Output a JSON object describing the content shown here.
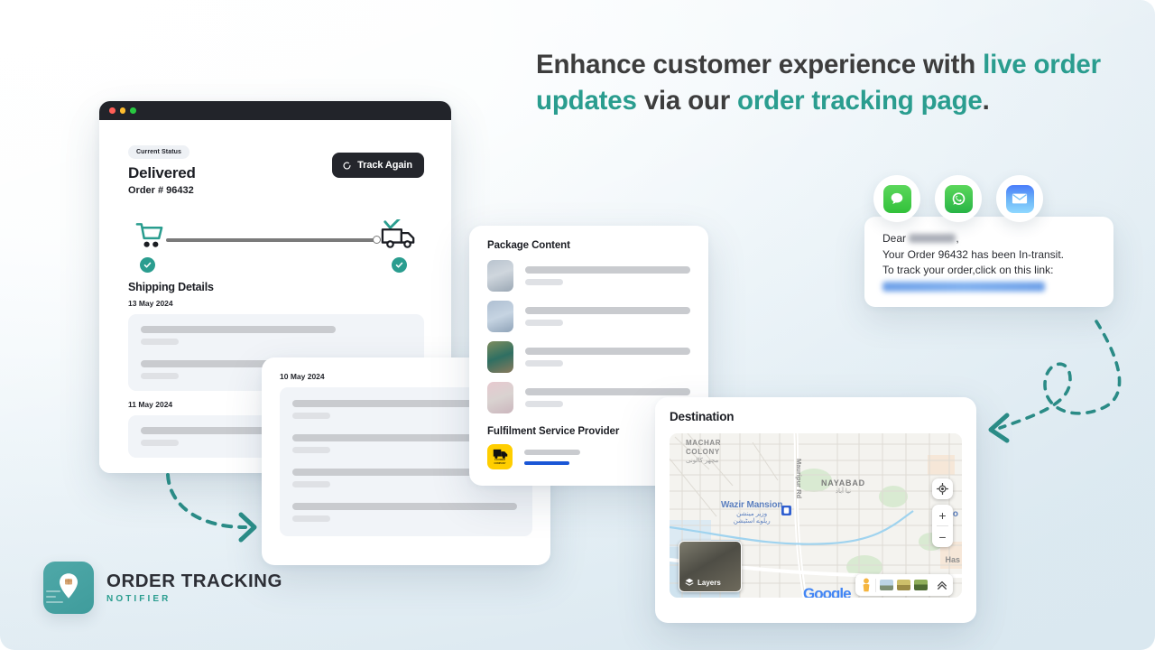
{
  "headline": {
    "part1": "Enhance customer experience with ",
    "accent1": "live order updates",
    "part2": " via our ",
    "accent2": "order tracking page",
    "part3": "."
  },
  "colors": {
    "accent_teal": "#2a9d8f",
    "dark": "#24262c",
    "progress_grey": "#7a7a7a",
    "bg_light": "#ffffff",
    "bg_blue": "#dfeaf1",
    "provider_yellow": "#ffce00",
    "provider_bar_blue": "#1a56d6"
  },
  "browser": {
    "status_badge": "Current Status",
    "status_title": "Delivered",
    "order_number": "Order # 96432",
    "track_button": "Track Again",
    "shipping_title": "Shipping Details",
    "date_1": "13 May 2024",
    "date_2": "11 May 2024"
  },
  "card_10may": {
    "date": "10 May 2024"
  },
  "package": {
    "title": "Package Content",
    "fulfilment_title": "Fulfilment Service Provider",
    "provider_caption_1": "COURIER",
    "provider_caption_2": "COMPANY",
    "items": [
      {
        "thumb": "dress-grey-floral"
      },
      {
        "thumb": "dress-blue"
      },
      {
        "thumb": "dress-teal-outdoor"
      },
      {
        "thumb": "dress-pink-print"
      }
    ]
  },
  "destination": {
    "title": "Destination",
    "map": {
      "label_machar": "MACHAR",
      "label_colony": "COLONY",
      "label_machar_urdu": "مچھر کالونی",
      "label_nayabad": "NAYABAD",
      "label_nayabad_urdu": "نیا آباد",
      "label_wazir": "Wazir Mansion",
      "label_wazir_urdu": "وزیر مینشن",
      "label_wazir_urdu2": "ریلوے اسٹیشن",
      "label_mauripur": "Mauripur Rd",
      "label_ho": "Ho",
      "label_has": "Has",
      "google_logo": "Google",
      "layers_label": "Layers",
      "control_locate": "locate-icon",
      "control_zoom_in": "+",
      "control_zoom_out": "−",
      "toolbar_expand": "chevron-up-icon"
    }
  },
  "message": {
    "line1_prefix": "Dear ",
    "line1_suffix": ",",
    "line2": "Your Order 96432 has been In-transit.",
    "line3": "To track your order,click on this link:",
    "channels": [
      "sms-icon",
      "whatsapp-icon",
      "mail-icon"
    ]
  },
  "logo": {
    "title": "ORDER TRACKING",
    "subtitle": "NOTIFIER"
  }
}
